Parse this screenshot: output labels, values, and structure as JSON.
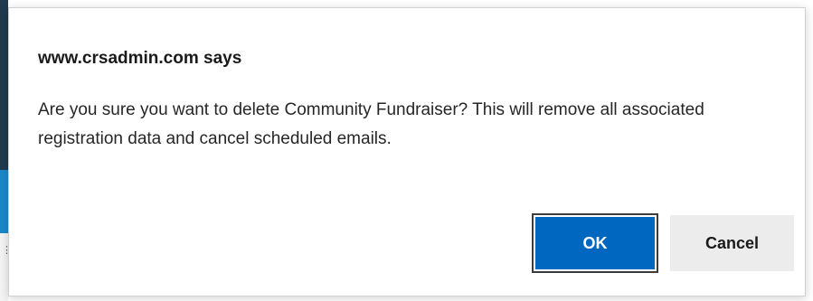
{
  "dialog": {
    "title": "www.crsadmin.com says",
    "message": "Are you sure you want to delete Community Fundraiser? This will remove all associated registration data and cancel scheduled emails.",
    "ok_label": "OK",
    "cancel_label": "Cancel"
  },
  "colors": {
    "ok_button": "#0067c0",
    "cancel_button": "#ececec",
    "page_sliver_dark": "#1f3a4f",
    "page_sliver_blue": "#1b88c9"
  }
}
